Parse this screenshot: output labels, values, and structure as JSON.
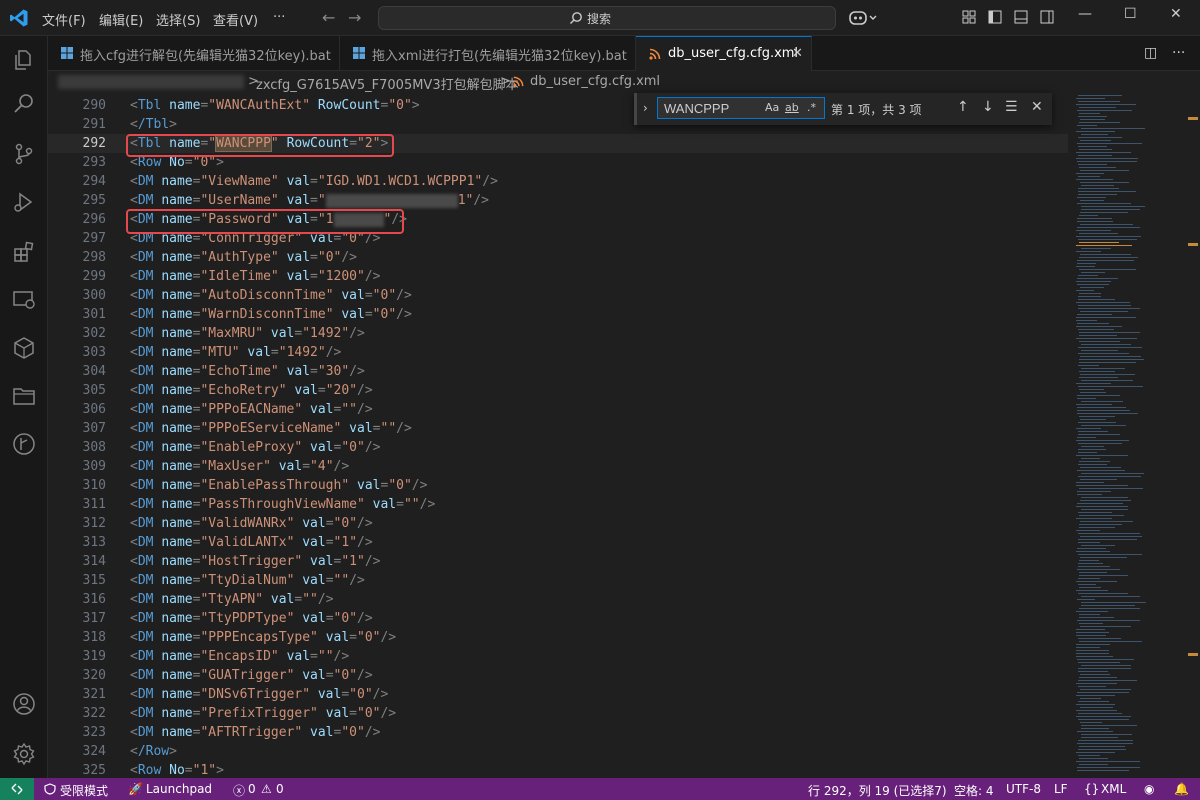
{
  "menu": [
    "文件(F)",
    "编辑(E)",
    "选择(S)",
    "查看(V)",
    "···"
  ],
  "search": {
    "label": "搜索"
  },
  "tabs": [
    {
      "label": "拖入cfg进行解包(先编辑光猫32位key).bat",
      "active": false
    },
    {
      "label": "拖入xml进行打包(先编辑光猫32位key).bat",
      "active": false
    },
    {
      "label": "db_user_cfg.cfg.xml",
      "active": true
    }
  ],
  "breadcrumb": {
    "folder": "zxcfg_G7615AV5_F7005MV3打包解包脚本",
    "sep": ">",
    "file": "db_user_cfg.cfg.xml"
  },
  "find": {
    "value": "WANCPPP",
    "case": "Aa",
    "word": "ab",
    "regex": ".*",
    "count": "第 1 项，共 3 项"
  },
  "editor": {
    "current_line": 292,
    "lines": [
      {
        "n": "290",
        "d": 1,
        "tag": "Tbl",
        "pairs": [
          [
            "name",
            "WANCAuthExt"
          ],
          [
            "RowCount",
            "0"
          ]
        ],
        "close": ">"
      },
      {
        "n": "291",
        "d": 1,
        "tag": "/Tbl",
        "pairs": [],
        "close": ">"
      },
      {
        "n": "292",
        "d": 1,
        "tag": "Tbl",
        "pairs": [
          [
            "name",
            "WANCPPP"
          ],
          [
            "RowCount",
            "2"
          ]
        ],
        "close": ">"
      },
      {
        "n": "293",
        "d": 1,
        "tag": "Row",
        "pairs": [
          [
            "No",
            "0"
          ]
        ],
        "close": ">"
      },
      {
        "n": "294",
        "d": 1,
        "tag": "DM",
        "pairs": [
          [
            "name",
            "ViewName"
          ],
          [
            "val",
            "IGD.WD1.WCD1.WCPPP1"
          ]
        ],
        "close": "/>"
      },
      {
        "n": "295",
        "d": 1,
        "tag": "DM",
        "pairs": [
          [
            "name",
            "UserName"
          ],
          [
            "val",
            "1"
          ]
        ],
        "close": "/>"
      },
      {
        "n": "296",
        "d": 1,
        "tag": "DM",
        "pairs": [
          [
            "name",
            "Password"
          ],
          [
            "val",
            "1"
          ]
        ],
        "close": "/>"
      },
      {
        "n": "297",
        "d": 1,
        "tag": "DM",
        "pairs": [
          [
            "name",
            "ConnTrigger"
          ],
          [
            "val",
            "0"
          ]
        ],
        "close": "/>"
      },
      {
        "n": "298",
        "d": 1,
        "tag": "DM",
        "pairs": [
          [
            "name",
            "AuthType"
          ],
          [
            "val",
            "0"
          ]
        ],
        "close": "/>"
      },
      {
        "n": "299",
        "d": 1,
        "tag": "DM",
        "pairs": [
          [
            "name",
            "IdleTime"
          ],
          [
            "val",
            "1200"
          ]
        ],
        "close": "/>"
      },
      {
        "n": "300",
        "d": 1,
        "tag": "DM",
        "pairs": [
          [
            "name",
            "AutoDisconnTime"
          ],
          [
            "val",
            "0"
          ]
        ],
        "close": "/>"
      },
      {
        "n": "301",
        "d": 1,
        "tag": "DM",
        "pairs": [
          [
            "name",
            "WarnDisconnTime"
          ],
          [
            "val",
            "0"
          ]
        ],
        "close": "/>"
      },
      {
        "n": "302",
        "d": 1,
        "tag": "DM",
        "pairs": [
          [
            "name",
            "MaxMRU"
          ],
          [
            "val",
            "1492"
          ]
        ],
        "close": "/>"
      },
      {
        "n": "303",
        "d": 1,
        "tag": "DM",
        "pairs": [
          [
            "name",
            "MTU"
          ],
          [
            "val",
            "1492"
          ]
        ],
        "close": "/>"
      },
      {
        "n": "304",
        "d": 1,
        "tag": "DM",
        "pairs": [
          [
            "name",
            "EchoTime"
          ],
          [
            "val",
            "30"
          ]
        ],
        "close": "/>"
      },
      {
        "n": "305",
        "d": 1,
        "tag": "DM",
        "pairs": [
          [
            "name",
            "EchoRetry"
          ],
          [
            "val",
            "20"
          ]
        ],
        "close": "/>"
      },
      {
        "n": "306",
        "d": 1,
        "tag": "DM",
        "pairs": [
          [
            "name",
            "PPPoEACName"
          ],
          [
            "val",
            ""
          ]
        ],
        "close": "/>"
      },
      {
        "n": "307",
        "d": 1,
        "tag": "DM",
        "pairs": [
          [
            "name",
            "PPPoEServiceName"
          ],
          [
            "val",
            ""
          ]
        ],
        "close": "/>"
      },
      {
        "n": "308",
        "d": 1,
        "tag": "DM",
        "pairs": [
          [
            "name",
            "EnableProxy"
          ],
          [
            "val",
            "0"
          ]
        ],
        "close": "/>"
      },
      {
        "n": "309",
        "d": 1,
        "tag": "DM",
        "pairs": [
          [
            "name",
            "MaxUser"
          ],
          [
            "val",
            "4"
          ]
        ],
        "close": "/>"
      },
      {
        "n": "310",
        "d": 1,
        "tag": "DM",
        "pairs": [
          [
            "name",
            "EnablePassThrough"
          ],
          [
            "val",
            "0"
          ]
        ],
        "close": "/>"
      },
      {
        "n": "311",
        "d": 1,
        "tag": "DM",
        "pairs": [
          [
            "name",
            "PassThroughViewName"
          ],
          [
            "val",
            ""
          ]
        ],
        "close": "/>"
      },
      {
        "n": "312",
        "d": 1,
        "tag": "DM",
        "pairs": [
          [
            "name",
            "ValidWANRx"
          ],
          [
            "val",
            "0"
          ]
        ],
        "close": "/>"
      },
      {
        "n": "313",
        "d": 1,
        "tag": "DM",
        "pairs": [
          [
            "name",
            "ValidLANTx"
          ],
          [
            "val",
            "1"
          ]
        ],
        "close": "/>"
      },
      {
        "n": "314",
        "d": 1,
        "tag": "DM",
        "pairs": [
          [
            "name",
            "HostTrigger"
          ],
          [
            "val",
            "1"
          ]
        ],
        "close": "/>"
      },
      {
        "n": "315",
        "d": 1,
        "tag": "DM",
        "pairs": [
          [
            "name",
            "TtyDialNum"
          ],
          [
            "val",
            ""
          ]
        ],
        "close": "/>"
      },
      {
        "n": "316",
        "d": 1,
        "tag": "DM",
        "pairs": [
          [
            "name",
            "TtyAPN"
          ],
          [
            "val",
            ""
          ]
        ],
        "close": "/>"
      },
      {
        "n": "317",
        "d": 1,
        "tag": "DM",
        "pairs": [
          [
            "name",
            "TtyPDPType"
          ],
          [
            "val",
            "0"
          ]
        ],
        "close": "/>"
      },
      {
        "n": "318",
        "d": 1,
        "tag": "DM",
        "pairs": [
          [
            "name",
            "PPPEncapsType"
          ],
          [
            "val",
            "0"
          ]
        ],
        "close": "/>"
      },
      {
        "n": "319",
        "d": 1,
        "tag": "DM",
        "pairs": [
          [
            "name",
            "EncapsID"
          ],
          [
            "val",
            ""
          ]
        ],
        "close": "/>"
      },
      {
        "n": "320",
        "d": 1,
        "tag": "DM",
        "pairs": [
          [
            "name",
            "GUATrigger"
          ],
          [
            "val",
            "0"
          ]
        ],
        "close": "/>"
      },
      {
        "n": "321",
        "d": 1,
        "tag": "DM",
        "pairs": [
          [
            "name",
            "DNSv6Trigger"
          ],
          [
            "val",
            "0"
          ]
        ],
        "close": "/>"
      },
      {
        "n": "322",
        "d": 1,
        "tag": "DM",
        "pairs": [
          [
            "name",
            "PrefixTrigger"
          ],
          [
            "val",
            "0"
          ]
        ],
        "close": "/>"
      },
      {
        "n": "323",
        "d": 1,
        "tag": "DM",
        "pairs": [
          [
            "name",
            "AFTRTrigger"
          ],
          [
            "val",
            "0"
          ]
        ],
        "close": "/>"
      },
      {
        "n": "324",
        "d": 1,
        "tag": "/Row",
        "pairs": [],
        "close": ">"
      },
      {
        "n": "325",
        "d": 1,
        "tag": "Row",
        "pairs": [
          [
            "No",
            "1"
          ]
        ],
        "close": ">"
      }
    ]
  },
  "status": {
    "restricted": "受限模式",
    "launchpad": "Launchpad",
    "errors": "0",
    "warnings": "0",
    "position": "行 292，列 19 (已选择7)",
    "indent": "空格: 4",
    "encoding": "UTF-8",
    "eol": "LF",
    "language": "XML"
  },
  "colors": {
    "statusbar": "#68217a",
    "accent": "#0078d4",
    "highlight_box": "#e5484d"
  }
}
